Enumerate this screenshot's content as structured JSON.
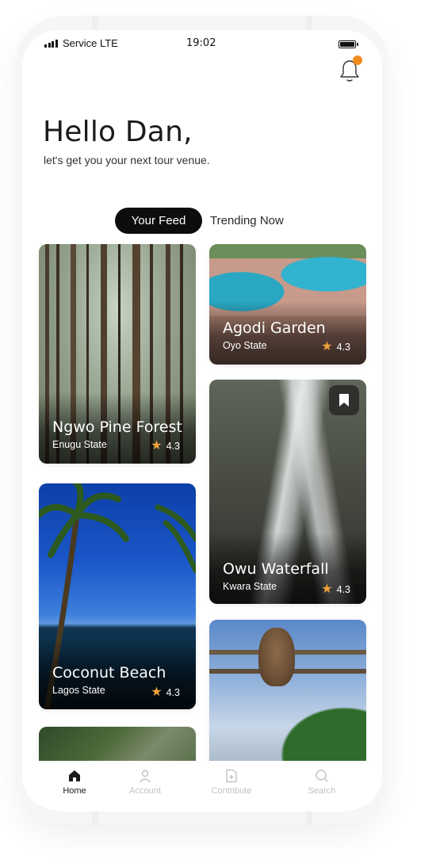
{
  "status_bar": {
    "carrier": "Service  LTE",
    "time": "19:02"
  },
  "header": {
    "greeting": "Hello Dan,",
    "subtitle": "let's get you your next tour venue."
  },
  "tabs": [
    {
      "label": "Your Feed",
      "active": true
    },
    {
      "label": "Trending Now",
      "active": false
    }
  ],
  "cards": {
    "forest": {
      "title": "Ngwo Pine Forest",
      "state": "Enugu State",
      "rating": "4.3"
    },
    "beach": {
      "title": "Coconut Beach",
      "state": "Lagos State",
      "rating": "4.3"
    },
    "agodi": {
      "title": "Agodi Garden",
      "state": "Oyo State",
      "rating": "4.3"
    },
    "waterfall": {
      "title": "Owu Waterfall",
      "state": "Kwara State",
      "rating": "4.3",
      "bookmarked": true
    }
  },
  "nav": {
    "home": "Home",
    "account": "Account",
    "contribute": "Contribute",
    "search": "Search"
  },
  "colors": {
    "accent": "#f28b1e",
    "star": "#f2a23a",
    "active_tab_bg": "#0d0d0d",
    "inactive_nav": "#c2c2c2"
  },
  "icons": [
    "signal-icon",
    "battery-icon",
    "bell-icon",
    "star-icon",
    "bookmark-icon",
    "home-icon",
    "account-icon",
    "contribute-icon",
    "search-icon"
  ]
}
